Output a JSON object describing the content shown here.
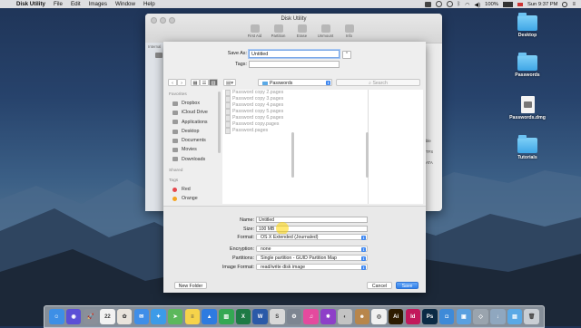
{
  "menubar": {
    "app_name": "Disk Utility",
    "items": [
      "File",
      "Edit",
      "Images",
      "Window",
      "Help"
    ],
    "battery": "100%",
    "clock": "Sun 9:37 PM"
  },
  "desktop": {
    "icons": [
      {
        "label": "Desktop",
        "type": "folder"
      },
      {
        "label": "Passwords",
        "type": "folder"
      },
      {
        "label": "Passwords.dmg",
        "type": "dmg"
      },
      {
        "label": "Tutorials",
        "type": "folder"
      }
    ]
  },
  "disk_utility": {
    "title": "Disk Utility",
    "toolbar": [
      "First Aid",
      "Partition",
      "Erase",
      "Unmount",
      "Info"
    ],
    "sidebar_label": "Internal",
    "fragments": [
      "ble",
      "TFS",
      "ATA"
    ]
  },
  "sheet": {
    "save_as_label": "Save As:",
    "save_as_value": "Untitled",
    "tags_label": "Tags:",
    "location": "Passwords",
    "search_placeholder": "Search",
    "sidebar": {
      "favorites_header": "Favorites",
      "favorites": [
        {
          "label": "Dropbox",
          "icon": "dropbox-icon"
        },
        {
          "label": "iCloud Drive",
          "icon": "cloud-icon"
        },
        {
          "label": "Applications",
          "icon": "applications-icon"
        },
        {
          "label": "Desktop",
          "icon": "desktop-icon"
        },
        {
          "label": "Documents",
          "icon": "documents-icon"
        },
        {
          "label": "Movies",
          "icon": "movies-icon"
        },
        {
          "label": "Downloads",
          "icon": "downloads-icon"
        }
      ],
      "shared_header": "Shared",
      "tags_header": "Tags",
      "tags": [
        {
          "label": "Red",
          "color": "#e5484d"
        },
        {
          "label": "Orange",
          "color": "#f5a623"
        }
      ]
    },
    "files": [
      "Password copy 2.pages",
      "Password copy 3.pages",
      "Password copy 4.pages",
      "Password copy 5.pages",
      "Password copy 6.pages",
      "Password copy.pages",
      "Password.pages"
    ],
    "options": {
      "name_label": "Name:",
      "name_value": "Untitled",
      "size_label": "Size:",
      "size_value": "100 MB",
      "format_label": "Format:",
      "format_value": "OS X Extended (Journaled)",
      "encryption_label": "Encryption:",
      "encryption_value": "none",
      "partitions_label": "Partitions:",
      "partitions_value": "Single partition - GUID Partition Map",
      "image_format_label": "Image Format:",
      "image_format_value": "read/write disk image"
    },
    "buttons": {
      "new_folder": "New Folder",
      "cancel": "Cancel",
      "save": "Save"
    }
  },
  "dock": {
    "apps": [
      {
        "name": "finder-icon",
        "color": "#3d8fe6",
        "glyph": "☺"
      },
      {
        "name": "siri-icon",
        "color": "#5b4fd6",
        "glyph": "◉"
      },
      {
        "name": "launchpad-icon",
        "color": "#8a8f99",
        "glyph": "🚀"
      },
      {
        "name": "calendar-icon",
        "color": "#f2f2f2",
        "glyph": "22"
      },
      {
        "name": "photos-icon",
        "color": "#e9e4dc",
        "glyph": "✿"
      },
      {
        "name": "mail-icon",
        "color": "#3f8ee8",
        "glyph": "✉"
      },
      {
        "name": "safari-icon",
        "color": "#3c9be8",
        "glyph": "✦"
      },
      {
        "name": "maps-icon",
        "color": "#5cb85c",
        "glyph": "➤"
      },
      {
        "name": "notes-icon",
        "color": "#f6d34a",
        "glyph": "≡"
      },
      {
        "name": "keynote-icon",
        "color": "#2e7be0",
        "glyph": "▲"
      },
      {
        "name": "numbers-icon",
        "color": "#34a853",
        "glyph": "▥"
      },
      {
        "name": "excel-icon",
        "color": "#1e7a45",
        "glyph": "X"
      },
      {
        "name": "word-icon",
        "color": "#2b5aa8",
        "glyph": "W"
      },
      {
        "name": "scripts-icon",
        "color": "#d8d8d8",
        "glyph": "S"
      },
      {
        "name": "system-preferences-icon",
        "color": "#7d8591",
        "glyph": "⚙"
      },
      {
        "name": "itunes-icon",
        "color": "#e44a9e",
        "glyph": "♫"
      },
      {
        "name": "affinity-icon",
        "color": "#8e3fc8",
        "glyph": "✸"
      },
      {
        "name": "photo-app-icon",
        "color": "#c3c3c3",
        "glyph": "◐"
      },
      {
        "name": "persona-icon",
        "color": "#b8864b",
        "glyph": "☻"
      },
      {
        "name": "chrome-icon",
        "color": "#f0f0f0",
        "glyph": "◎"
      },
      {
        "name": "illustrator-icon",
        "color": "#2d1b00",
        "glyph": "Ai"
      },
      {
        "name": "indesign-icon",
        "color": "#c2185b",
        "glyph": "Id"
      },
      {
        "name": "photoshop-icon",
        "color": "#0b2a45",
        "glyph": "Ps"
      },
      {
        "name": "camera-icon",
        "color": "#3e8ad8",
        "glyph": "◘"
      },
      {
        "name": "preview-icon",
        "color": "#5aa0e0",
        "glyph": "▣"
      },
      {
        "name": "utility-icon",
        "color": "#9aa4ae",
        "glyph": "◇"
      },
      {
        "name": "downloads-stack-icon",
        "color": "#8fa7bf",
        "glyph": "↓"
      },
      {
        "name": "folder-stack-icon",
        "color": "#5aa9e6",
        "glyph": "▤"
      },
      {
        "name": "trash-icon",
        "color": "#c9ced4",
        "glyph": "🗑"
      }
    ]
  }
}
